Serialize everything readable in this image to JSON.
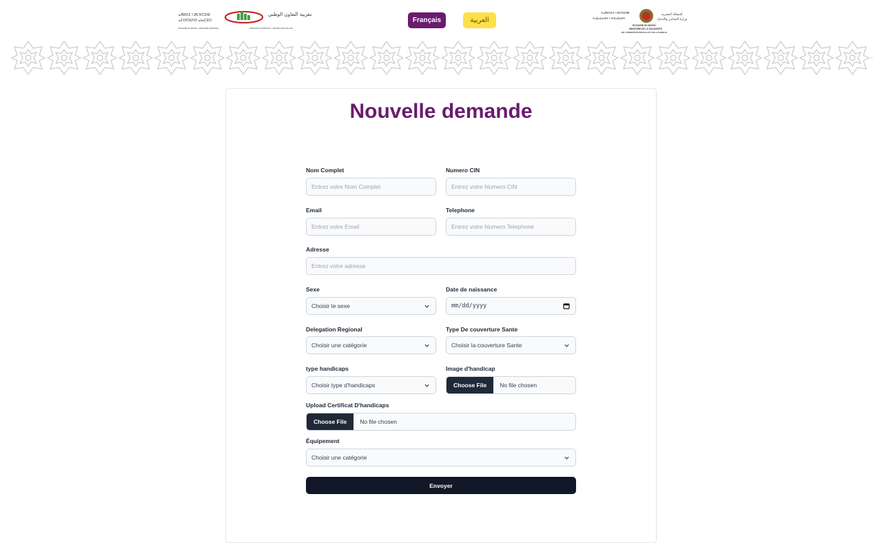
{
  "header": {
    "logo_left_latin": "ROYAUME DU MAROC - ENTRAIDE NATIONALE",
    "logo_left_latin2": "KINGDOM OF MOROCCO - NATIONAL MUTUAL AID",
    "logo_left_arabic": "المملكة المغربية التعاون الوطني",
    "logo_right_latin": "ROYAUME DU MAROC",
    "logo_right_latin2": "MINISTERE DE LA SOLIDARITE",
    "logo_right_latin3": "DE L'INSERTION SOCIALE ET DE LA FAMILLE",
    "lang_fr": "Français",
    "lang_ar": "العربية"
  },
  "form": {
    "title": "Nouvelle demande",
    "nom": {
      "label": "Nom Complet",
      "placeholder": "Entrez votre Nom Complet"
    },
    "cin": {
      "label": "Numero CIN",
      "placeholder": "Entrez votre Numero CIN"
    },
    "email": {
      "label": "Email",
      "placeholder": "Entrez votre Email"
    },
    "tel": {
      "label": "Telephone",
      "placeholder": "Entrez votre Numero Telephone"
    },
    "adresse": {
      "label": "Adresse",
      "placeholder": "Entrez votre adresse"
    },
    "sexe": {
      "label": "Sexe",
      "value": "Choisir le sexe"
    },
    "naissance": {
      "label": "Date de naissance",
      "value": "mm/dd/yyyy"
    },
    "delegation": {
      "label": "Delegation Regional",
      "value": "Choisir une catégorie"
    },
    "couverture": {
      "label": "Type De couverture Sante",
      "value": "Choisir la couverture Sante"
    },
    "handicap": {
      "label": "type handicaps",
      "value": "Choisir type d'handicaps"
    },
    "image": {
      "label": "Image d'handicap",
      "button": "Choose File",
      "status": "No file chosen"
    },
    "certificat": {
      "label": "Upload Certificat D'handicaps",
      "button": "Choose File",
      "status": "No file chosen"
    },
    "equipement": {
      "label": "Équipement",
      "value": "Choisir une catégorie"
    },
    "submit": "Envoyer"
  },
  "colors": {
    "brand": "#6a1b6f",
    "accent_yellow": "#fde047",
    "dark": "#111827"
  }
}
